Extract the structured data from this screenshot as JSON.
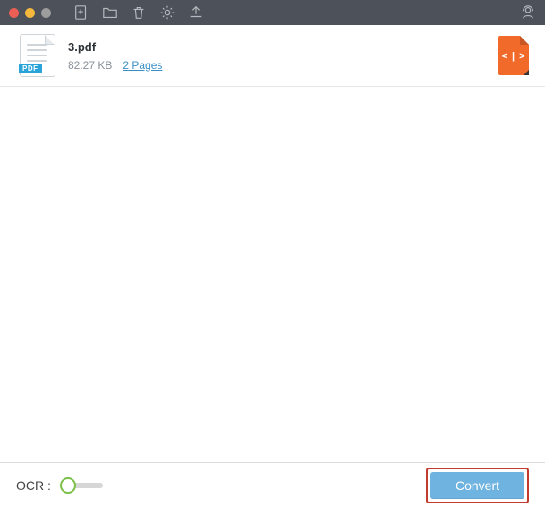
{
  "toolbar": {
    "icons": {
      "add": "add-document-icon",
      "folder": "folder-icon",
      "trash": "trash-icon",
      "settings": "gear-icon",
      "upload": "upload-icon",
      "user": "user-support-icon"
    }
  },
  "file": {
    "name": "3.pdf",
    "size": "82.27 KB",
    "pages": "2 Pages",
    "badge": "PDF",
    "output_glyph": "< | >"
  },
  "footer": {
    "ocr_label": "OCR :",
    "convert_label": "Convert"
  },
  "colors": {
    "accent_orange": "#f26a2a",
    "accent_blue_link": "#3a8fc7",
    "convert_btn": "#6fb3e0",
    "highlight_border": "#c23b2f",
    "toggle_ring": "#7cc04b",
    "titlebar": "#4d525a"
  }
}
